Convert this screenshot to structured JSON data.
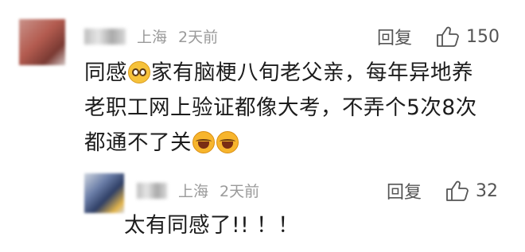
{
  "comment": {
    "location": "上海",
    "time": "2天前",
    "reply_label": "回复",
    "like_count": "150",
    "text_line1_a": "同感",
    "text_line1_b": "家有脑梗八旬老父亲，每年异地养",
    "text_line2": "老职工网上验证都像大考，不弄个5次8次",
    "text_line3": "都通不了关",
    "emojis": [
      "pleading-face-icon",
      "laughing-tears-icon",
      "laughing-tears-icon"
    ]
  },
  "reply": {
    "location": "上海",
    "time": "2天前",
    "reply_label": "回复",
    "like_count": "32",
    "text": "太有同感了!!  ！！"
  }
}
